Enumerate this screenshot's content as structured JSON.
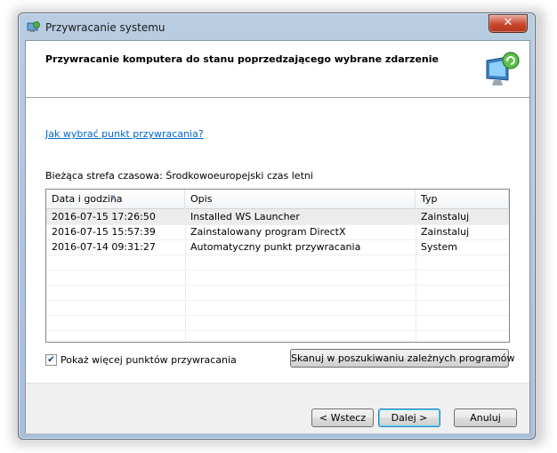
{
  "window": {
    "title": "Przywracanie systemu",
    "close_label": "✕"
  },
  "header": {
    "title": "Przywracanie komputera do stanu poprzedzającego wybrane zdarzenie"
  },
  "help_link": "Jak wybrać punkt przywracania?",
  "timezone_label": "Bieżąca strefa czasowa: Środkowoeuropejski czas letni",
  "table": {
    "columns": [
      "Data i godzina",
      "Opis",
      "Typ"
    ],
    "rows": [
      [
        "2016-07-15 17:26:50",
        "Installed WS Launcher",
        "Zainstaluj"
      ],
      [
        "2016-07-15 15:57:39",
        "Zainstalowany program DirectX",
        "Zainstaluj"
      ],
      [
        "2016-07-14 09:31:27",
        "Automatyczny punkt przywracania",
        "System"
      ]
    ],
    "selected_row": 0
  },
  "show_more": {
    "label": "Pokaż więcej punktów przywracania",
    "checked": true,
    "check_glyph": "✔"
  },
  "scan_button": "Skanuj w poszukiwaniu zależnych programów",
  "footer": {
    "back": "< Wstecz",
    "next": "Dalej >",
    "cancel": "Anuluj"
  }
}
